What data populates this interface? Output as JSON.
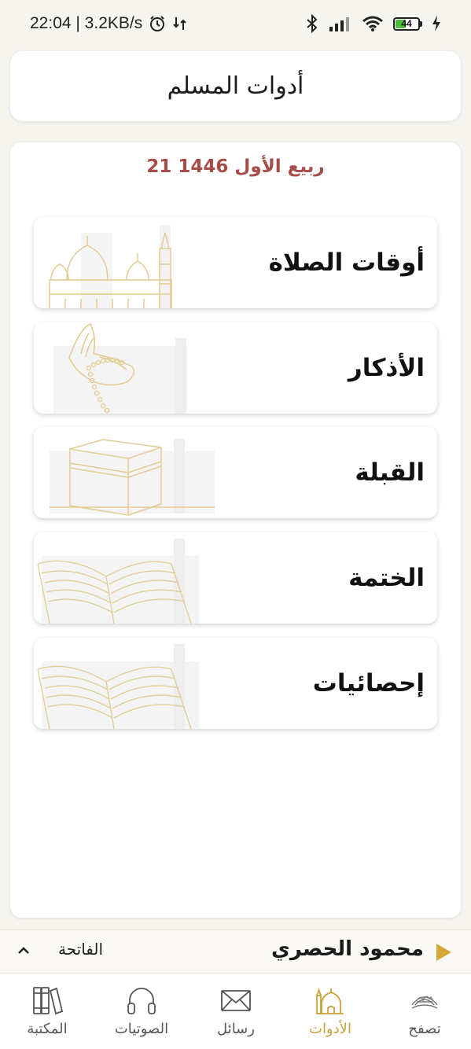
{
  "status_bar": {
    "time_speed": "22:04 | 3.2KB/s",
    "battery_level": "44"
  },
  "header": {
    "title": "أدوات المسلم"
  },
  "main": {
    "hijri_date": "21 ربيع الأول 1446",
    "tools": [
      {
        "label": "أوقات الصلاة",
        "art": "mosque-illustration"
      },
      {
        "label": "الأذكار",
        "art": "prayer-hands-illustration"
      },
      {
        "label": "القبلة",
        "art": "kaaba-illustration"
      },
      {
        "label": "الختمة",
        "art": "open-quran-illustration"
      },
      {
        "label": "إحصائيات",
        "art": "open-quran-illustration"
      }
    ]
  },
  "player": {
    "reciter": "محمود الحصري",
    "surah": "الفاتحة"
  },
  "bottom_nav": {
    "items": [
      {
        "label": "تصفح",
        "icon": "mushaf-icon"
      },
      {
        "label": "الأدوات",
        "icon": "mosque-icon",
        "active": true
      },
      {
        "label": "رسائل",
        "icon": "envelope-icon"
      },
      {
        "label": "الصوتيات",
        "icon": "headphones-icon"
      },
      {
        "label": "المكتبة",
        "icon": "books-icon"
      }
    ]
  },
  "colors": {
    "accent": "#c9a33a",
    "date": "#a64d4a",
    "battery": "#4cbd38",
    "art": "#e0c98a"
  }
}
